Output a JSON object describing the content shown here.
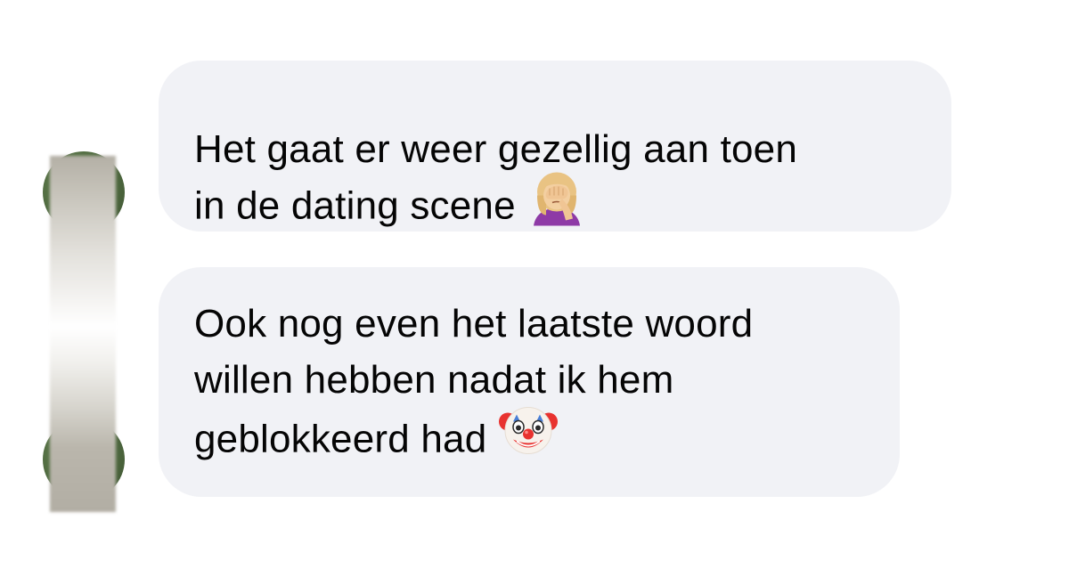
{
  "messages": [
    {
      "lines": [
        "Het gaat er weer gezellig aan toen",
        "in de dating scene"
      ],
      "emoji": "woman-facepalming-emoji"
    },
    {
      "lines": [
        "Ook nog even het laatste woord",
        "willen hebben nadat ik hem",
        "geblokkeerd had"
      ],
      "emoji": "clown-face-emoji"
    }
  ],
  "colors": {
    "bubble_bg": "#f1f2f6",
    "text": "#050505",
    "page_bg": "#ffffff"
  }
}
